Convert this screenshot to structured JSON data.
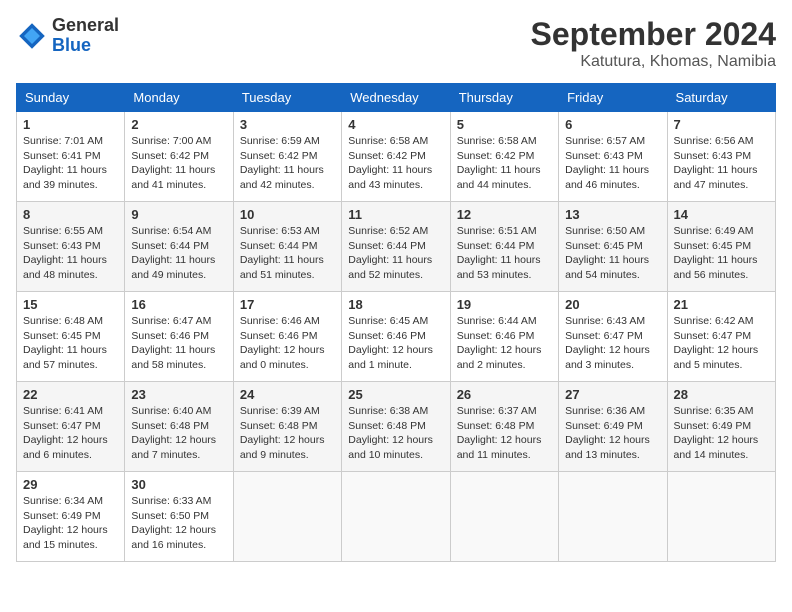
{
  "header": {
    "logo_general": "General",
    "logo_blue": "Blue",
    "month_title": "September 2024",
    "location": "Katutura, Khomas, Namibia"
  },
  "days_of_week": [
    "Sunday",
    "Monday",
    "Tuesday",
    "Wednesday",
    "Thursday",
    "Friday",
    "Saturday"
  ],
  "weeks": [
    [
      {
        "day": 1,
        "info": "Sunrise: 7:01 AM\nSunset: 6:41 PM\nDaylight: 11 hours\nand 39 minutes."
      },
      {
        "day": 2,
        "info": "Sunrise: 7:00 AM\nSunset: 6:42 PM\nDaylight: 11 hours\nand 41 minutes."
      },
      {
        "day": 3,
        "info": "Sunrise: 6:59 AM\nSunset: 6:42 PM\nDaylight: 11 hours\nand 42 minutes."
      },
      {
        "day": 4,
        "info": "Sunrise: 6:58 AM\nSunset: 6:42 PM\nDaylight: 11 hours\nand 43 minutes."
      },
      {
        "day": 5,
        "info": "Sunrise: 6:58 AM\nSunset: 6:42 PM\nDaylight: 11 hours\nand 44 minutes."
      },
      {
        "day": 6,
        "info": "Sunrise: 6:57 AM\nSunset: 6:43 PM\nDaylight: 11 hours\nand 46 minutes."
      },
      {
        "day": 7,
        "info": "Sunrise: 6:56 AM\nSunset: 6:43 PM\nDaylight: 11 hours\nand 47 minutes."
      }
    ],
    [
      {
        "day": 8,
        "info": "Sunrise: 6:55 AM\nSunset: 6:43 PM\nDaylight: 11 hours\nand 48 minutes."
      },
      {
        "day": 9,
        "info": "Sunrise: 6:54 AM\nSunset: 6:44 PM\nDaylight: 11 hours\nand 49 minutes."
      },
      {
        "day": 10,
        "info": "Sunrise: 6:53 AM\nSunset: 6:44 PM\nDaylight: 11 hours\nand 51 minutes."
      },
      {
        "day": 11,
        "info": "Sunrise: 6:52 AM\nSunset: 6:44 PM\nDaylight: 11 hours\nand 52 minutes."
      },
      {
        "day": 12,
        "info": "Sunrise: 6:51 AM\nSunset: 6:44 PM\nDaylight: 11 hours\nand 53 minutes."
      },
      {
        "day": 13,
        "info": "Sunrise: 6:50 AM\nSunset: 6:45 PM\nDaylight: 11 hours\nand 54 minutes."
      },
      {
        "day": 14,
        "info": "Sunrise: 6:49 AM\nSunset: 6:45 PM\nDaylight: 11 hours\nand 56 minutes."
      }
    ],
    [
      {
        "day": 15,
        "info": "Sunrise: 6:48 AM\nSunset: 6:45 PM\nDaylight: 11 hours\nand 57 minutes."
      },
      {
        "day": 16,
        "info": "Sunrise: 6:47 AM\nSunset: 6:46 PM\nDaylight: 11 hours\nand 58 minutes."
      },
      {
        "day": 17,
        "info": "Sunrise: 6:46 AM\nSunset: 6:46 PM\nDaylight: 12 hours\nand 0 minutes."
      },
      {
        "day": 18,
        "info": "Sunrise: 6:45 AM\nSunset: 6:46 PM\nDaylight: 12 hours\nand 1 minute."
      },
      {
        "day": 19,
        "info": "Sunrise: 6:44 AM\nSunset: 6:46 PM\nDaylight: 12 hours\nand 2 minutes."
      },
      {
        "day": 20,
        "info": "Sunrise: 6:43 AM\nSunset: 6:47 PM\nDaylight: 12 hours\nand 3 minutes."
      },
      {
        "day": 21,
        "info": "Sunrise: 6:42 AM\nSunset: 6:47 PM\nDaylight: 12 hours\nand 5 minutes."
      }
    ],
    [
      {
        "day": 22,
        "info": "Sunrise: 6:41 AM\nSunset: 6:47 PM\nDaylight: 12 hours\nand 6 minutes."
      },
      {
        "day": 23,
        "info": "Sunrise: 6:40 AM\nSunset: 6:48 PM\nDaylight: 12 hours\nand 7 minutes."
      },
      {
        "day": 24,
        "info": "Sunrise: 6:39 AM\nSunset: 6:48 PM\nDaylight: 12 hours\nand 9 minutes."
      },
      {
        "day": 25,
        "info": "Sunrise: 6:38 AM\nSunset: 6:48 PM\nDaylight: 12 hours\nand 10 minutes."
      },
      {
        "day": 26,
        "info": "Sunrise: 6:37 AM\nSunset: 6:48 PM\nDaylight: 12 hours\nand 11 minutes."
      },
      {
        "day": 27,
        "info": "Sunrise: 6:36 AM\nSunset: 6:49 PM\nDaylight: 12 hours\nand 13 minutes."
      },
      {
        "day": 28,
        "info": "Sunrise: 6:35 AM\nSunset: 6:49 PM\nDaylight: 12 hours\nand 14 minutes."
      }
    ],
    [
      {
        "day": 29,
        "info": "Sunrise: 6:34 AM\nSunset: 6:49 PM\nDaylight: 12 hours\nand 15 minutes."
      },
      {
        "day": 30,
        "info": "Sunrise: 6:33 AM\nSunset: 6:50 PM\nDaylight: 12 hours\nand 16 minutes."
      },
      null,
      null,
      null,
      null,
      null
    ]
  ]
}
